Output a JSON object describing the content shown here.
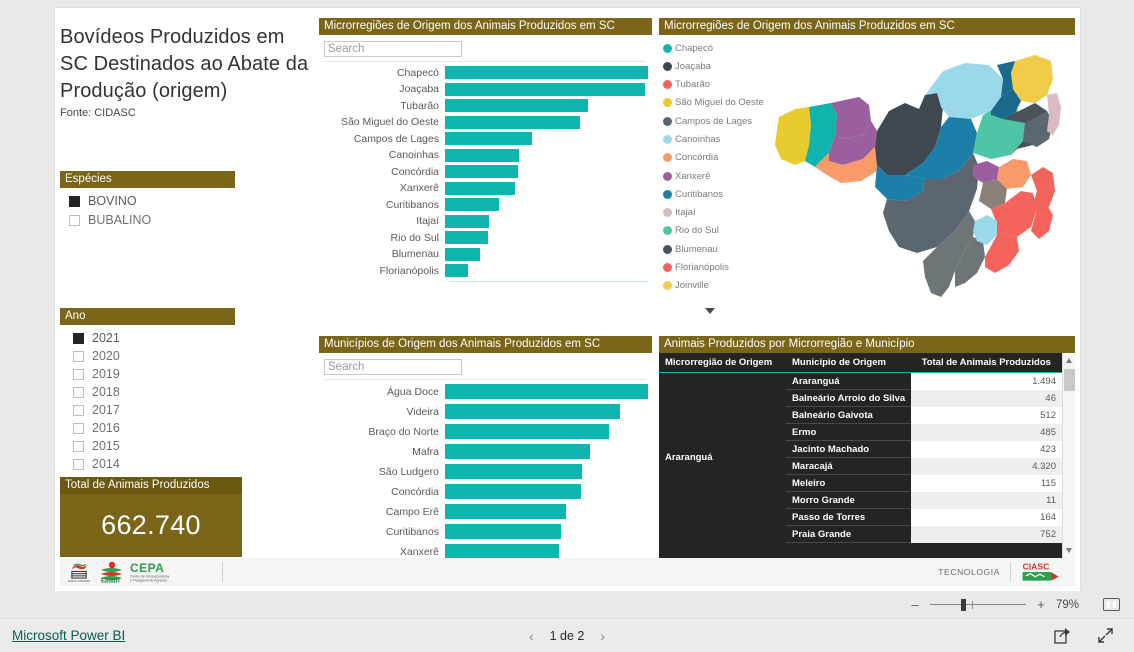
{
  "report": {
    "title": "Bovídeos Produzidos em SC Destinados ao Abate da Produção  (origem)",
    "source": "Fonte: CIDASC"
  },
  "slicer_especies": {
    "header": "Espécies",
    "items": [
      {
        "label": "BOVINO",
        "checked": true
      },
      {
        "label": "BUBALINO",
        "checked": false
      }
    ]
  },
  "slicer_ano": {
    "header": "Ano",
    "items": [
      {
        "label": "2021",
        "checked": true
      },
      {
        "label": "2020",
        "checked": false
      },
      {
        "label": "2019",
        "checked": false
      },
      {
        "label": "2018",
        "checked": false
      },
      {
        "label": "2017",
        "checked": false
      },
      {
        "label": "2016",
        "checked": false
      },
      {
        "label": "2015",
        "checked": false
      },
      {
        "label": "2014",
        "checked": false
      }
    ]
  },
  "kpi": {
    "header": "Total de Animais Produzidos",
    "value": "662.740"
  },
  "vis_micro": {
    "header": "Microrregiões de Origem dos Animais Produzidos em SC",
    "search_placeholder": "Search",
    "search_value": ""
  },
  "vis_muni": {
    "header": "Municípios de Origem dos Animais Produzidos em SC",
    "search_placeholder": "Search",
    "search_value": ""
  },
  "vis_map": {
    "header": "Microrregiões de Origem dos Animais Produzidos em SC",
    "legend": [
      {
        "label": "Chapecó",
        "color": "#0fb5ad"
      },
      {
        "label": "Joaçaba",
        "color": "#3f484f"
      },
      {
        "label": "Tubarão",
        "color": "#f4645d"
      },
      {
        "label": "São Miguel do Oeste",
        "color": "#e8cb2d"
      },
      {
        "label": "Campos de Lages",
        "color": "#5c6670"
      },
      {
        "label": "Canoinhas",
        "color": "#9bd9ea"
      },
      {
        "label": "Concórdia",
        "color": "#f89a6a"
      },
      {
        "label": "Xanxerê",
        "color": "#9b5fa0"
      },
      {
        "label": "Curitibanos",
        "color": "#1c7fa8"
      },
      {
        "label": "Itajaí",
        "color": "#d8bcc0"
      },
      {
        "label": "Rio do Sul",
        "color": "#4ec5a5"
      },
      {
        "label": "Blumenau",
        "color": "#4a535a"
      },
      {
        "label": "Florianópolis",
        "color": "#f2655f"
      },
      {
        "label": "Joinville",
        "color": "#f0cc49"
      }
    ]
  },
  "vis_table": {
    "header": "Animais Produzidos por Microrregião e Município",
    "columns": [
      "Microrregião de Origem",
      "Município de Origem",
      "Total de Animais Produzidos"
    ],
    "group_label": "Araranguá",
    "rows": [
      {
        "municipio": "Araranguá",
        "total": "1.494"
      },
      {
        "municipio": "Balneário Arroio do Silva",
        "total": "46"
      },
      {
        "municipio": "Balneário Gaivota",
        "total": "512"
      },
      {
        "municipio": "Ermo",
        "total": "485"
      },
      {
        "municipio": "Jacinto Machado",
        "total": "423"
      },
      {
        "municipio": "Maracajá",
        "total": "4.320"
      },
      {
        "municipio": "Meleiro",
        "total": "115"
      },
      {
        "municipio": "Morro Grande",
        "total": "11"
      },
      {
        "municipio": "Passo de Torres",
        "total": "164"
      },
      {
        "municipio": "Praia Grande",
        "total": "752"
      }
    ]
  },
  "footer": {
    "tecnologia": "TECNOLOGIA",
    "cepa_name": "CEPA",
    "cepa_sub": "Centro de Socioeconomia e Planejamento Agrícola",
    "epagri_name": "Epagri",
    "ciasc_name": "CIASC"
  },
  "zoom_bar": {
    "minus": "–",
    "plus": "+",
    "percent": "79%"
  },
  "nav_bar": {
    "brand": "Microsoft Power BI",
    "prev": "‹",
    "next": "›",
    "page_indicator": "1 de 2"
  },
  "chart_data": [
    {
      "type": "bar",
      "orientation": "horizontal",
      "title": "Microrregiões de Origem dos Animais Produzidos em SC",
      "xlabel": "",
      "ylabel": "",
      "grid": false,
      "legend": "none",
      "bar_color": "#0fb5ad",
      "categories": [
        "Chapecó",
        "Joaçaba",
        "Tubarão",
        "São Miguel do Oeste",
        "Campos de Lages",
        "Canoinhas",
        "Concórdia",
        "Xanxerê",
        "Curitibanos",
        "Itajaí",
        "Rio do Sul",
        "Blumenau",
        "Florianópolis"
      ],
      "values": [
        100,
        98.5,
        70.5,
        66.5,
        43,
        36.5,
        36,
        34.5,
        26.5,
        21.5,
        21,
        17,
        11.5
      ]
    },
    {
      "type": "bar",
      "orientation": "horizontal",
      "title": "Municípios de Origem dos Animais Produzidos em SC",
      "xlabel": "",
      "ylabel": "",
      "grid": false,
      "legend": "none",
      "bar_color": "#0fb5ad",
      "categories": [
        "Água Doce",
        "Videira",
        "Braço do Norte",
        "Mafra",
        "São Ludgero",
        "Concórdia",
        "Campo Erê",
        "Curitibanos",
        "Xanxerê"
      ],
      "values": [
        100,
        86,
        81,
        71.5,
        67.5,
        67,
        59.5,
        57,
        56
      ]
    },
    {
      "type": "heatmap",
      "title": "Microrregiões de Origem dos Animais Produzidos em SC",
      "subtype": "choropleth-map",
      "region": "Santa Catarina, Brasil",
      "categories": [
        "Chapecó",
        "Joaçaba",
        "Tubarão",
        "São Miguel do Oeste",
        "Campos de Lages",
        "Canoinhas",
        "Concórdia",
        "Xanxerê",
        "Curitibanos",
        "Itajaí",
        "Rio do Sul",
        "Blumenau",
        "Florianópolis",
        "Joinville"
      ],
      "legend_position": "left"
    },
    {
      "type": "table",
      "title": "Animais Produzidos por Microrregião e Município",
      "columns": [
        "Microrregião de Origem",
        "Município de Origem",
        "Total de Animais Produzidos"
      ],
      "rows": [
        [
          "Araranguá",
          "Araranguá",
          1494
        ],
        [
          "",
          "Balneário Arroio do Silva",
          46
        ],
        [
          "",
          "Balneário Gaivota",
          512
        ],
        [
          "",
          "Ermo",
          485
        ],
        [
          "",
          "Jacinto Machado",
          423
        ],
        [
          "",
          "Maracajá",
          4320
        ],
        [
          "",
          "Meleiro",
          115
        ],
        [
          "",
          "Morro Grande",
          11
        ],
        [
          "",
          "Passo de Torres",
          164
        ],
        [
          "",
          "Praia Grande",
          752
        ]
      ]
    }
  ]
}
